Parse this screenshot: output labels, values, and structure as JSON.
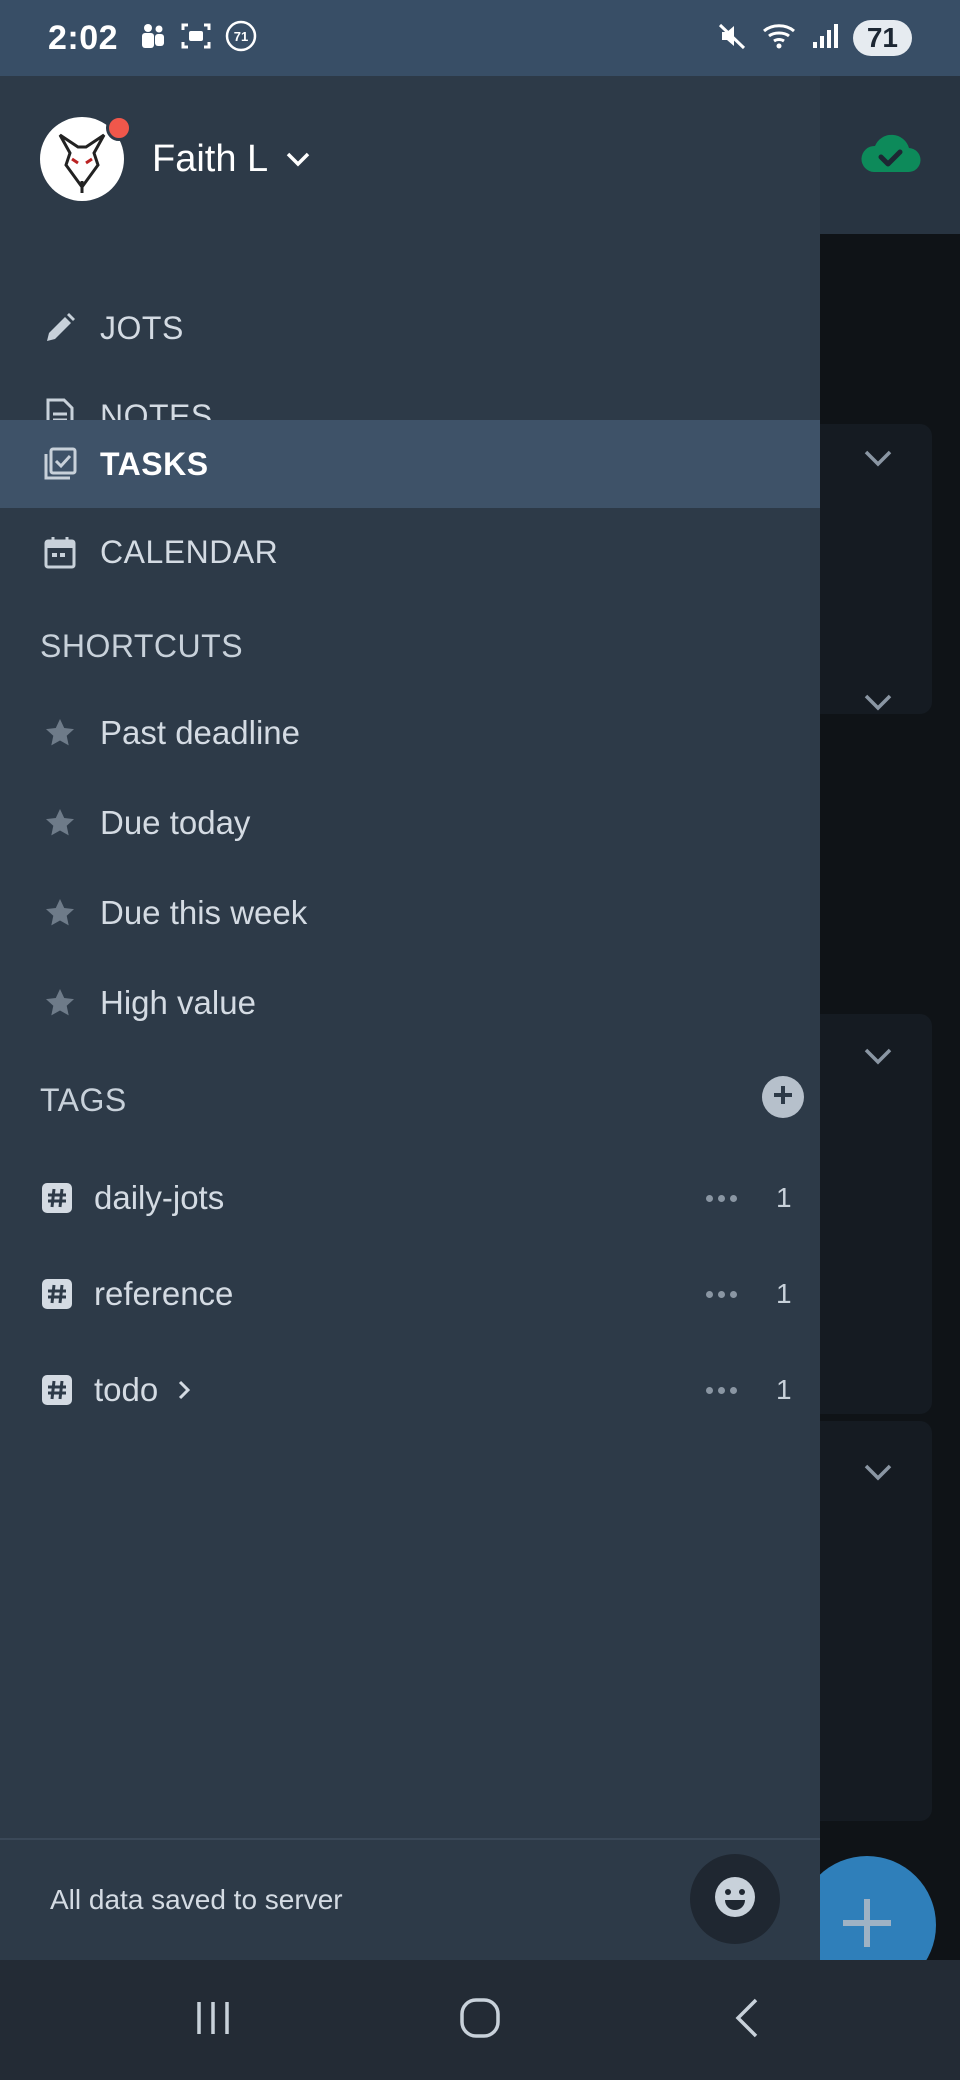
{
  "status_bar": {
    "time": "2:02",
    "left_icons": [
      "teams-icon",
      "screenshot-icon",
      "badge-71-icon"
    ],
    "badge_number": "71",
    "right_icons": [
      "mute-icon",
      "wifi-icon",
      "signal-icon"
    ],
    "battery": "71"
  },
  "drawer": {
    "profile": {
      "name": "Faith L"
    },
    "nav_items": [
      {
        "label": "JOTS",
        "icon": "pencil-icon",
        "active": false
      },
      {
        "label": "NOTES",
        "icon": "notes-icon",
        "active": false
      },
      {
        "label": "TASKS",
        "icon": "tasks-icon",
        "active": true
      },
      {
        "label": "CALENDAR",
        "icon": "calendar-icon",
        "active": false
      }
    ],
    "shortcuts": {
      "title": "SHORTCUTS",
      "items": [
        "Past deadline",
        "Due today",
        "Due this week",
        "High value"
      ]
    },
    "tags": {
      "title": "TAGS",
      "items": [
        {
          "label": "daily-jots",
          "count": "1"
        },
        {
          "label": "reference",
          "count": "1"
        },
        {
          "label": "todo",
          "count": "1"
        }
      ]
    },
    "footer": {
      "status": "All data saved to server"
    }
  },
  "colors": {
    "status_bar": "#384e66",
    "drawer": "#2d3a48",
    "active_item": "#3e5268",
    "fab": "#2f7fba",
    "cloud_ok": "#0d8a5a"
  }
}
